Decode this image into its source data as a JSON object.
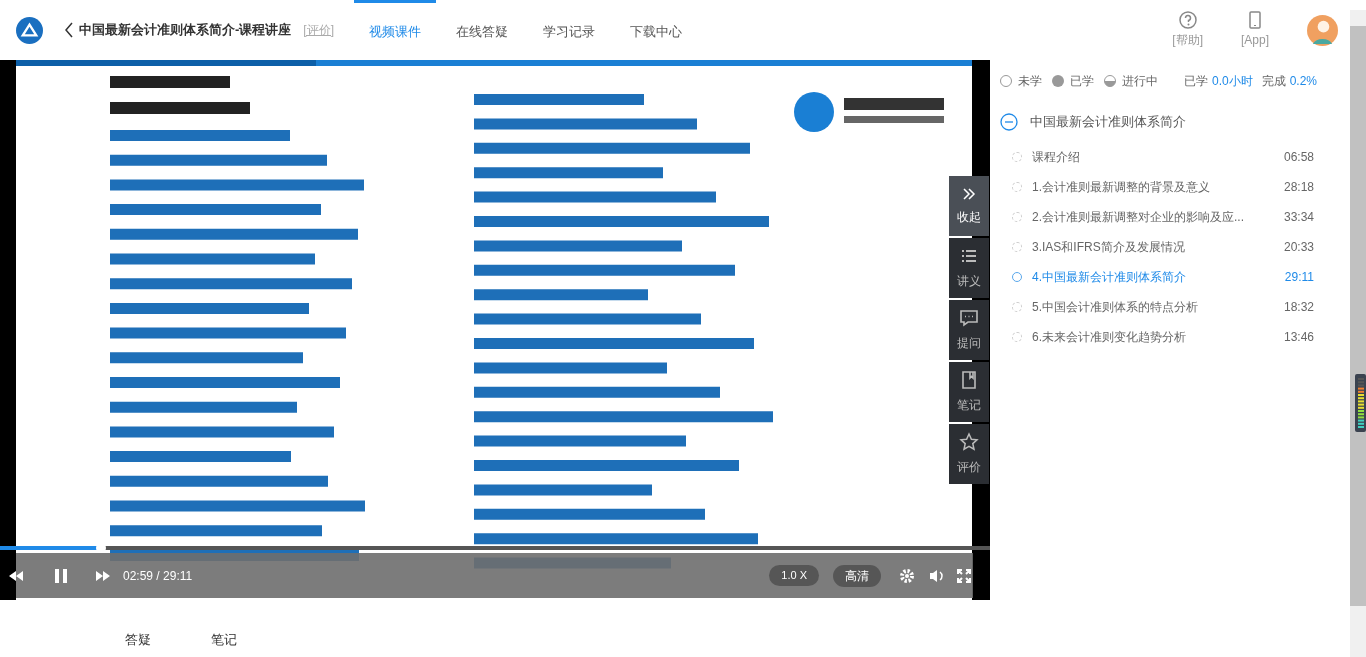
{
  "header": {
    "title": "中国最新会计准则体系简介-课程讲座",
    "rate_link": "[评价]",
    "tabs": [
      {
        "label": "视频课件",
        "selected": true
      },
      {
        "label": "在线答疑",
        "selected": false
      },
      {
        "label": "学习记录",
        "selected": false
      },
      {
        "label": "下载中心",
        "selected": false
      }
    ],
    "actions": [
      {
        "kind": "help",
        "label": "[帮助]"
      },
      {
        "kind": "app",
        "label": "[App]"
      }
    ]
  },
  "player": {
    "time": "02:59 / 29:11",
    "speed": "1.0 X",
    "quality": "高清",
    "progress": {
      "level": 0.102
    },
    "playing": true
  },
  "side_tools": [
    {
      "kind": "collapse",
      "label": "收起",
      "selected": true
    },
    {
      "kind": "handout",
      "label": "讲义",
      "selected": false
    },
    {
      "kind": "question",
      "label": "提问",
      "selected": false
    },
    {
      "kind": "notes",
      "label": "笔记",
      "selected": false
    },
    {
      "kind": "rate",
      "label": "评价",
      "selected": false
    }
  ],
  "legend": [
    {
      "kind": "empty",
      "label": "未学"
    },
    {
      "kind": "done",
      "label": "已学"
    },
    {
      "kind": "half",
      "label": "进行中"
    }
  ],
  "summary": {
    "studied_label": "已学",
    "studied": "0.0小时",
    "complete_label": "完成",
    "complete": "0.2%"
  },
  "chapter": {
    "title": "中国最新会计准则体系简介",
    "expanded": true,
    "lessons": [
      {
        "title": "课程介绍",
        "duration": "06:58",
        "selected": false
      },
      {
        "title": "1.会计准则最新调整的背景及意义",
        "duration": "28:18",
        "selected": false
      },
      {
        "title": "2.会计准则最新调整对企业的影响及应...",
        "duration": "33:34",
        "selected": false
      },
      {
        "title": "3.IAS和IFRS简介及发展情况",
        "duration": "20:33",
        "selected": false
      },
      {
        "title": "4.中国最新会计准则体系简介",
        "duration": "29:11",
        "selected": true
      },
      {
        "title": "5.中国会计准则体系的特点分析",
        "duration": "18:32",
        "selected": false
      },
      {
        "title": "6.未来会计准则变化趋势分析",
        "duration": "13:46",
        "selected": false
      }
    ]
  },
  "bottom_tabs": [
    {
      "label": "答疑"
    },
    {
      "label": "笔记"
    }
  ]
}
